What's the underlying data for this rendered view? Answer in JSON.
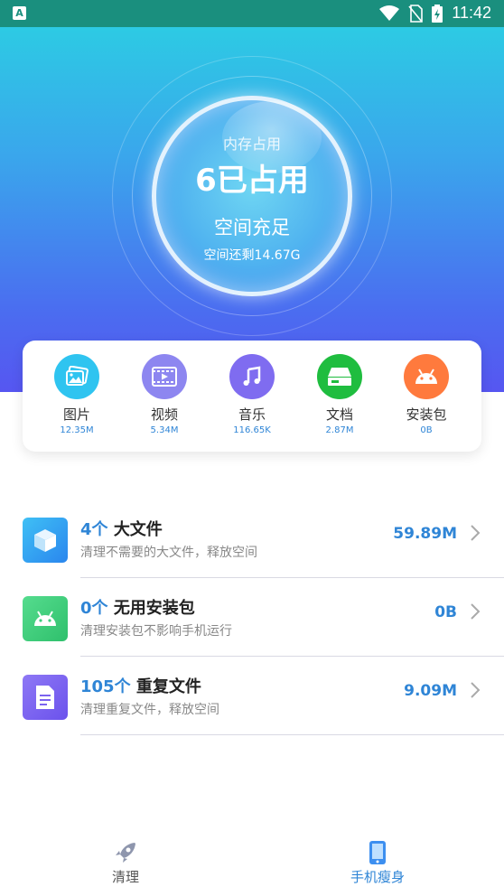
{
  "status_bar": {
    "time": "11:42"
  },
  "storage": {
    "title": "内存占用",
    "used_text": "6已占用",
    "status": "空间充足",
    "remaining": "空间还剩14.67G"
  },
  "categories": [
    {
      "label": "图片",
      "size": "12.35M",
      "icon": "image-icon",
      "color": "#2fc4f0"
    },
    {
      "label": "视频",
      "size": "5.34M",
      "icon": "video-icon",
      "color": "#8d86f0"
    },
    {
      "label": "音乐",
      "size": "116.65K",
      "icon": "music-icon",
      "color": "#7f6cf0"
    },
    {
      "label": "文档",
      "size": "2.87M",
      "icon": "document-icon",
      "color": "#1fbd3f"
    },
    {
      "label": "安装包",
      "size": "0B",
      "icon": "android-icon",
      "color": "#ff7a3d"
    }
  ],
  "cleanup_items": [
    {
      "count": "4个",
      "title": "大文件",
      "subtitle": "清理不需要的大文件，释放空间",
      "size": "59.89M",
      "icon": "cube-icon",
      "color": "#2ea0f0"
    },
    {
      "count": "0个",
      "title": "无用安装包",
      "subtitle": "清理安装包不影响手机运行",
      "size": "0B",
      "icon": "android-icon",
      "color": "#3fcf7e"
    },
    {
      "count": "105个",
      "title": "重复文件",
      "subtitle": "清理重复文件，释放空间",
      "size": "9.09M",
      "icon": "file-icon",
      "color": "#7b63ef"
    }
  ],
  "bottom_nav": [
    {
      "label": "清理",
      "icon": "rocket-icon",
      "active": false
    },
    {
      "label": "手机瘦身",
      "icon": "phone-icon",
      "active": true
    }
  ],
  "colors": {
    "accent": "#2f85d6",
    "status_bar": "#1a8f7e"
  }
}
